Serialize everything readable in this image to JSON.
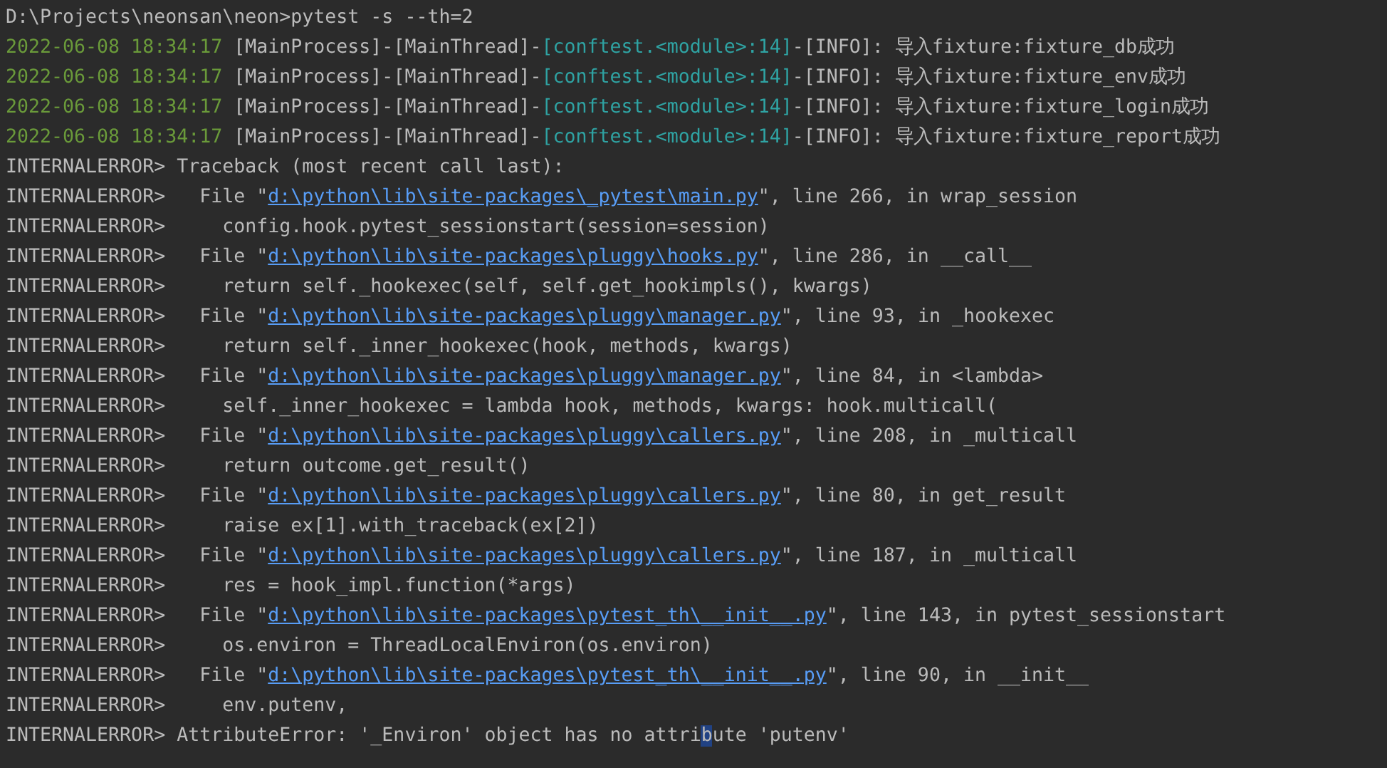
{
  "terminal": {
    "lines": [
      {
        "segments": [
          {
            "kind": "plain",
            "text": "D:\\Projects\\neonsan\\neon>pytest -s --th=2"
          }
        ]
      },
      {
        "segments": [
          {
            "kind": "timestamp",
            "text": "2022-06-08 18:34:17"
          },
          {
            "kind": "plain",
            "text": " [MainProcess]-[MainThread]-"
          },
          {
            "kind": "module",
            "text": "[conftest.<module>:14]"
          },
          {
            "kind": "plain",
            "text": "-[INFO]: 导入fixture:fixture_db成功"
          }
        ]
      },
      {
        "segments": [
          {
            "kind": "timestamp",
            "text": "2022-06-08 18:34:17"
          },
          {
            "kind": "plain",
            "text": " [MainProcess]-[MainThread]-"
          },
          {
            "kind": "module",
            "text": "[conftest.<module>:14]"
          },
          {
            "kind": "plain",
            "text": "-[INFO]: 导入fixture:fixture_env成功"
          }
        ]
      },
      {
        "segments": [
          {
            "kind": "timestamp",
            "text": "2022-06-08 18:34:17"
          },
          {
            "kind": "plain",
            "text": " [MainProcess]-[MainThread]-"
          },
          {
            "kind": "module",
            "text": "[conftest.<module>:14]"
          },
          {
            "kind": "plain",
            "text": "-[INFO]: 导入fixture:fixture_login成功"
          }
        ]
      },
      {
        "segments": [
          {
            "kind": "timestamp",
            "text": "2022-06-08 18:34:17"
          },
          {
            "kind": "plain",
            "text": " [MainProcess]-[MainThread]-"
          },
          {
            "kind": "module",
            "text": "[conftest.<module>:14]"
          },
          {
            "kind": "plain",
            "text": "-[INFO]: 导入fixture:fixture_report成功"
          }
        ]
      },
      {
        "segments": [
          {
            "kind": "plain",
            "text": "INTERNALERROR> Traceback (most recent call last):"
          }
        ]
      },
      {
        "segments": [
          {
            "kind": "plain",
            "text": "INTERNALERROR>   File \""
          },
          {
            "kind": "link",
            "text": "d:\\python\\lib\\site-packages\\_pytest\\main.py"
          },
          {
            "kind": "plain",
            "text": "\", line 266, in wrap_session"
          }
        ]
      },
      {
        "segments": [
          {
            "kind": "plain",
            "text": "INTERNALERROR>     config.hook.pytest_sessionstart(session=session)"
          }
        ]
      },
      {
        "segments": [
          {
            "kind": "plain",
            "text": "INTERNALERROR>   File \""
          },
          {
            "kind": "link",
            "text": "d:\\python\\lib\\site-packages\\pluggy\\hooks.py"
          },
          {
            "kind": "plain",
            "text": "\", line 286, in __call__"
          }
        ]
      },
      {
        "segments": [
          {
            "kind": "plain",
            "text": "INTERNALERROR>     return self._hookexec(self, self.get_hookimpls(), kwargs)"
          }
        ]
      },
      {
        "segments": [
          {
            "kind": "plain",
            "text": "INTERNALERROR>   File \""
          },
          {
            "kind": "link",
            "text": "d:\\python\\lib\\site-packages\\pluggy\\manager.py"
          },
          {
            "kind": "plain",
            "text": "\", line 93, in _hookexec"
          }
        ]
      },
      {
        "segments": [
          {
            "kind": "plain",
            "text": "INTERNALERROR>     return self._inner_hookexec(hook, methods, kwargs)"
          }
        ]
      },
      {
        "segments": [
          {
            "kind": "plain",
            "text": "INTERNALERROR>   File \""
          },
          {
            "kind": "link",
            "text": "d:\\python\\lib\\site-packages\\pluggy\\manager.py"
          },
          {
            "kind": "plain",
            "text": "\", line 84, in <lambda>"
          }
        ]
      },
      {
        "segments": [
          {
            "kind": "plain",
            "text": "INTERNALERROR>     self._inner_hookexec = lambda hook, methods, kwargs: hook.multicall("
          }
        ]
      },
      {
        "segments": [
          {
            "kind": "plain",
            "text": "INTERNALERROR>   File \""
          },
          {
            "kind": "link",
            "text": "d:\\python\\lib\\site-packages\\pluggy\\callers.py"
          },
          {
            "kind": "plain",
            "text": "\", line 208, in _multicall"
          }
        ]
      },
      {
        "segments": [
          {
            "kind": "plain",
            "text": "INTERNALERROR>     return outcome.get_result()"
          }
        ]
      },
      {
        "segments": [
          {
            "kind": "plain",
            "text": "INTERNALERROR>   File \""
          },
          {
            "kind": "link",
            "text": "d:\\python\\lib\\site-packages\\pluggy\\callers.py"
          },
          {
            "kind": "plain",
            "text": "\", line 80, in get_result"
          }
        ]
      },
      {
        "segments": [
          {
            "kind": "plain",
            "text": "INTERNALERROR>     raise ex[1].with_traceback(ex[2])"
          }
        ]
      },
      {
        "segments": [
          {
            "kind": "plain",
            "text": "INTERNALERROR>   File \""
          },
          {
            "kind": "link",
            "text": "d:\\python\\lib\\site-packages\\pluggy\\callers.py"
          },
          {
            "kind": "plain",
            "text": "\", line 187, in _multicall"
          }
        ]
      },
      {
        "segments": [
          {
            "kind": "plain",
            "text": "INTERNALERROR>     res = hook_impl.function(*args)"
          }
        ]
      },
      {
        "segments": [
          {
            "kind": "plain",
            "text": "INTERNALERROR>   File \""
          },
          {
            "kind": "link",
            "text": "d:\\python\\lib\\site-packages\\pytest_th\\__init__.py"
          },
          {
            "kind": "plain",
            "text": "\", line 143, in pytest_sessionstart"
          }
        ]
      },
      {
        "segments": [
          {
            "kind": "plain",
            "text": "INTERNALERROR>     os.environ = ThreadLocalEnviron(os.environ)"
          }
        ]
      },
      {
        "segments": [
          {
            "kind": "plain",
            "text": "INTERNALERROR>   File \""
          },
          {
            "kind": "link",
            "text": "d:\\python\\lib\\site-packages\\pytest_th\\__init__.py"
          },
          {
            "kind": "plain",
            "text": "\", line 90, in __init__"
          }
        ]
      },
      {
        "segments": [
          {
            "kind": "plain",
            "text": "INTERNALERROR>     env.putenv,"
          }
        ]
      },
      {
        "segments": [
          {
            "kind": "plain",
            "text": "INTERNALERROR> AttributeError: '_Environ' object has no attri"
          },
          {
            "kind": "cursor",
            "text": "b"
          },
          {
            "kind": "plain",
            "text": "ute 'putenv'"
          }
        ]
      }
    ]
  }
}
